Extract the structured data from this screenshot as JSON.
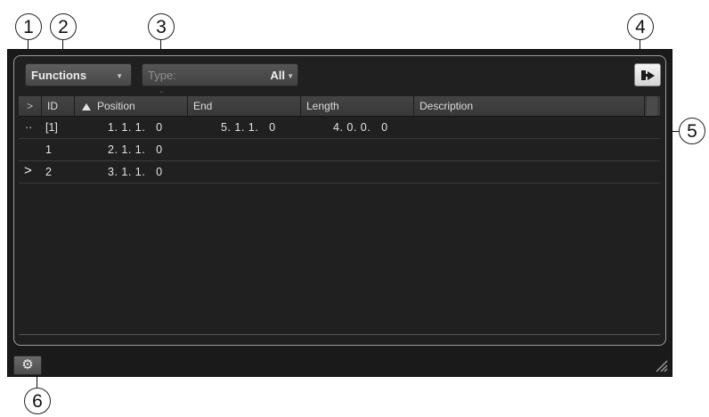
{
  "callouts": [
    "1",
    "2",
    "3",
    "4",
    "5",
    "6"
  ],
  "toolbar": {
    "functions_label": "Functions",
    "type_placeholder": "Type:",
    "type_value": "All",
    "sync_icon": "show-hide-inspector-icon"
  },
  "table": {
    "headers": {
      "select": ">",
      "id": "ID",
      "position": "Position",
      "end": "End",
      "length": "Length",
      "description": "Description"
    },
    "rows": [
      {
        "marker": "··",
        "id": "[1]",
        "position": "1. 1. 1.   0",
        "end": "5. 1. 1.   0",
        "length": "4. 0. 0.   0",
        "description": ""
      },
      {
        "marker": "",
        "id": "1",
        "position": "2. 1. 1.   0",
        "end": "",
        "length": "",
        "description": ""
      },
      {
        "marker": ">",
        "id": "2",
        "position": "3. 1. 1.   0",
        "end": "",
        "length": "",
        "description": ""
      }
    ]
  },
  "statusbar": {
    "settings_icon": "gear-icon",
    "resize_icon": "resize-grip-icon"
  }
}
